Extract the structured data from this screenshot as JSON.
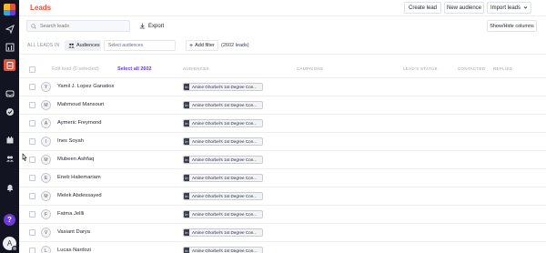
{
  "app": {
    "page_title": "Leads"
  },
  "header": {
    "create_lead": "Create lead",
    "new_audience": "New audience",
    "import_leads": "Import leads"
  },
  "toolbar": {
    "search_placeholder": "Search leads",
    "export_label": "Export",
    "show_hide_columns": "Show/Hide columns"
  },
  "filters": {
    "all_leads_in": "ALL LEADS IN",
    "audiences_label": "Audiences",
    "select_audiences_placeholder": "Select audiences",
    "add_filter": "Add filter",
    "lead_count": "(2602 leads)"
  },
  "table": {
    "edit_lead": "Edit lead",
    "selected_count": "(0 selected)",
    "select_all": "Select all 2602",
    "columns": {
      "audiences": "AUDIENCES",
      "campaigns": "CAMPAIGNS",
      "status": "LEAD'S STATUS",
      "contacted": "CONTACTED",
      "replied": "REPLIED"
    },
    "rows": [
      {
        "initial": "Y",
        "name": "Yamil J. Lopez Ganatios",
        "audience": "Amine Ghorbel's 1st Degree Con..."
      },
      {
        "initial": "M",
        "name": "Mahmoud Mansouri",
        "audience": "Amine Ghorbel's 1st Degree Con..."
      },
      {
        "initial": "A",
        "name": "Aymeric Freymond",
        "audience": "Amine Ghorbel's 1st Degree Con..."
      },
      {
        "initial": "I",
        "name": "Ines Soyah",
        "audience": "Amine Ghorbel's 1st Degree Con..."
      },
      {
        "initial": "M",
        "name": "Mubeen Ashfaq",
        "audience": "Amine Ghorbel's 1st Degree Con..."
      },
      {
        "initial": "E",
        "name": "Eneb Haliemariam",
        "audience": "Amine Ghorbel's 1st Degree Con..."
      },
      {
        "initial": "M",
        "name": "Melek Abdessayed",
        "audience": "Amine Ghorbel's 1st Degree Con..."
      },
      {
        "initial": "F",
        "name": "Fatma Jellli",
        "audience": "Amine Ghorbel's 1st Degree Con..."
      },
      {
        "initial": "V",
        "name": "Vasiant Darya",
        "audience": "Amine Ghorbel's 1st Degree Con..."
      },
      {
        "initial": "L",
        "name": "Lucas Nardozi",
        "audience": "Amine Ghorbel's 1st Degree Con..."
      }
    ]
  },
  "sidebar": {
    "help_label": "?",
    "avatar_initial": "A",
    "icons": [
      "send-icon",
      "bar-chart-icon",
      "leads-icon",
      "inbox-icon",
      "check-circle-icon",
      "calendar-icon",
      "team-icon",
      "bell-icon"
    ]
  },
  "colors": {
    "accent": "#e0543f",
    "purple": "#6a3bd6",
    "rail_bg": "#121521"
  }
}
